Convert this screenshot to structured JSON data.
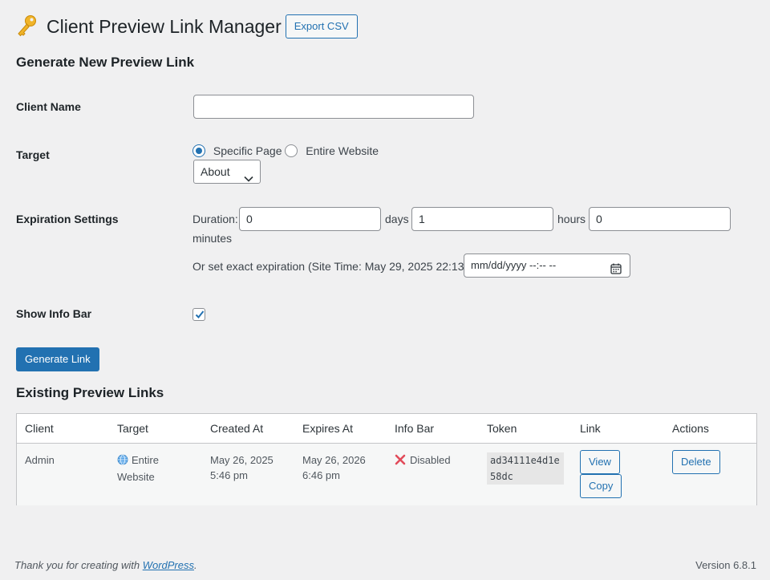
{
  "header": {
    "key_icon": "key-icon",
    "title": "Client Preview Link Manager",
    "export_label": "Export CSV"
  },
  "form": {
    "section_title": "Generate New Preview Link",
    "client_name": {
      "label": "Client Name",
      "value": ""
    },
    "target": {
      "label": "Target",
      "options": [
        {
          "label": "Specific Page",
          "checked": true
        },
        {
          "label": "Entire Website",
          "checked": false
        }
      ],
      "page_select_value": "About"
    },
    "expiration": {
      "label": "Expiration Settings",
      "duration_label": "Duration:",
      "days_value": "0",
      "days_label": "days",
      "hours_value": "1",
      "hours_label": "hours",
      "minutes_value": "0",
      "minutes_label": "minutes",
      "exact_label": "Or set exact expiration (Site Time: May 29, 2025 22:13):",
      "datetime_placeholder": "mm/dd/yyyy --:-- --"
    },
    "info_bar": {
      "label": "Show Info Bar",
      "checked": true
    },
    "generate_label": "Generate Link"
  },
  "existing": {
    "section_title": "Existing Preview Links",
    "columns": [
      "Client",
      "Target",
      "Created At",
      "Expires At",
      "Info Bar",
      "Token",
      "Link",
      "Actions"
    ],
    "rows": [
      {
        "client": "Admin",
        "target_icon": "globe-icon",
        "target_line1": "Entire",
        "target_line2": "Website",
        "created_line1": "May 26, 2025",
        "created_line2": "5:46 pm",
        "expires_line1": "May 26, 2026",
        "expires_line2": "6:46 pm",
        "info_bar_icon": "red-x-icon",
        "info_bar": "Disabled",
        "token": "ad34111e4d1e58dc",
        "view_label": "View",
        "copy_label": "Copy",
        "delete_label": "Delete"
      }
    ]
  },
  "footer": {
    "thanks_prefix": "Thank you for creating with ",
    "wordpress_link": "WordPress",
    "thanks_suffix": ".",
    "version": "Version 6.8.1"
  },
  "colors": {
    "primary": "#2271b1",
    "background": "#f0f0f1",
    "danger": "#d63638"
  }
}
